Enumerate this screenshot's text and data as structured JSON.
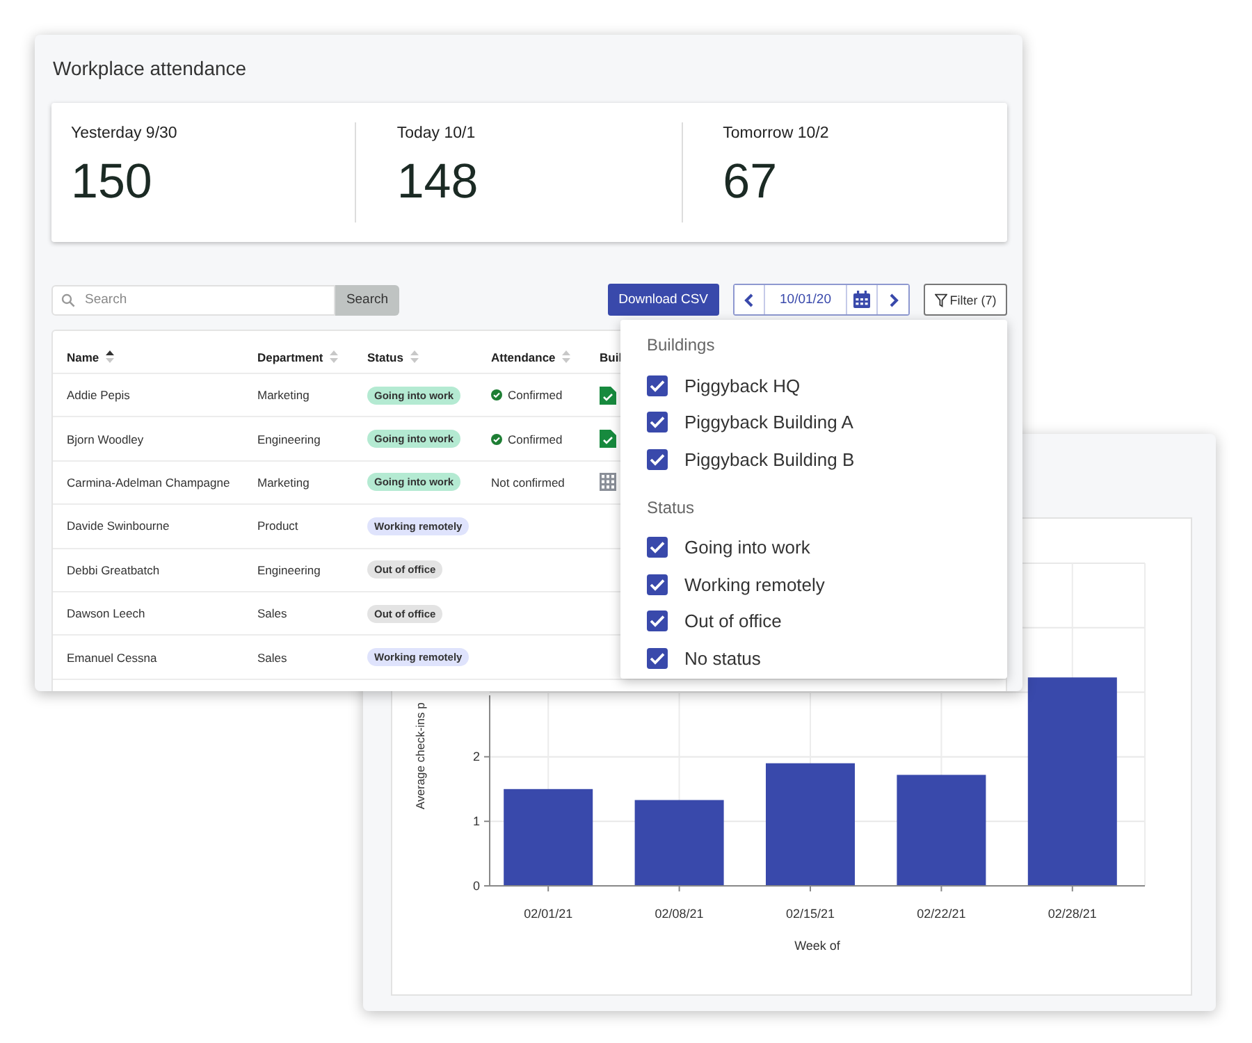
{
  "attendance_panel": {
    "title": "Workplace attendance",
    "stats": [
      {
        "label": "Yesterday 9/30",
        "value": "150"
      },
      {
        "label": "Today 10/1",
        "value": "148"
      },
      {
        "label": "Tomorrow 10/2",
        "value": "67"
      }
    ],
    "search": {
      "placeholder": "Search",
      "button": "Search"
    },
    "download_button": "Download CSV",
    "date_picker": {
      "date": "10/01/20"
    },
    "filter_button": "Filter (7)",
    "table": {
      "columns": [
        {
          "label": "Name",
          "sortable": true,
          "sorted": true
        },
        {
          "label": "Department",
          "sortable": true,
          "sorted": false
        },
        {
          "label": "Status",
          "sortable": true,
          "sorted": false
        },
        {
          "label": "Attendance",
          "sortable": true,
          "sorted": false
        },
        {
          "label": "Buil"
        }
      ],
      "rows": [
        {
          "name": "Addie Pepis",
          "department": "Marketing",
          "status": {
            "label": "Going into work",
            "kind": "going"
          },
          "attendance": {
            "label": "Confirmed",
            "confirmed": true
          },
          "checked_in": true
        },
        {
          "name": "Bjorn Woodley",
          "department": "Engineering",
          "status": {
            "label": "Going into work",
            "kind": "going"
          },
          "attendance": {
            "label": "Confirmed",
            "confirmed": true
          },
          "checked_in": true
        },
        {
          "name": "Carmina-Adelman Champagne",
          "department": "Marketing",
          "status": {
            "label": "Going into work",
            "kind": "going"
          },
          "attendance": {
            "label": "Not confirmed",
            "confirmed": false
          },
          "checked_in": false
        },
        {
          "name": "Davide Swinbourne",
          "department": "Product",
          "status": {
            "label": "Working remotely",
            "kind": "remote"
          }
        },
        {
          "name": "Debbi Greatbatch",
          "department": "Engineering",
          "status": {
            "label": "Out of office",
            "kind": "out"
          }
        },
        {
          "name": "Dawson Leech",
          "department": "Sales",
          "status": {
            "label": "Out of office",
            "kind": "out"
          }
        },
        {
          "name": "Emanuel Cessna",
          "department": "Sales",
          "status": {
            "label": "Working remotely",
            "kind": "remote"
          }
        }
      ]
    },
    "filter_menu": {
      "sections": [
        {
          "title": "Buildings",
          "options": [
            {
              "label": "Piggyback HQ",
              "checked": true
            },
            {
              "label": "Piggyback Building A",
              "checked": true
            },
            {
              "label": "Piggyback Building B",
              "checked": true
            }
          ]
        },
        {
          "title": "Status",
          "options": [
            {
              "label": "Going into work",
              "checked": true
            },
            {
              "label": "Working remotely",
              "checked": true
            },
            {
              "label": "Out of office",
              "checked": true
            },
            {
              "label": "No status",
              "checked": true
            }
          ]
        }
      ]
    }
  },
  "chart_panel": {
    "chart_data": {
      "type": "bar",
      "xlabel": "Week of",
      "ylabel": "Average check-ins p",
      "categories": [
        "02/01/21",
        "02/08/21",
        "02/15/21",
        "02/22/21",
        "02/28/21"
      ],
      "series": [
        {
          "color": "#3949ab",
          "values": [
            1.5,
            1.33,
            1.9,
            1.72,
            3.23
          ]
        }
      ],
      "ylim": [
        0,
        5
      ],
      "yticks": [
        0,
        1,
        2
      ],
      "grid": true
    }
  }
}
